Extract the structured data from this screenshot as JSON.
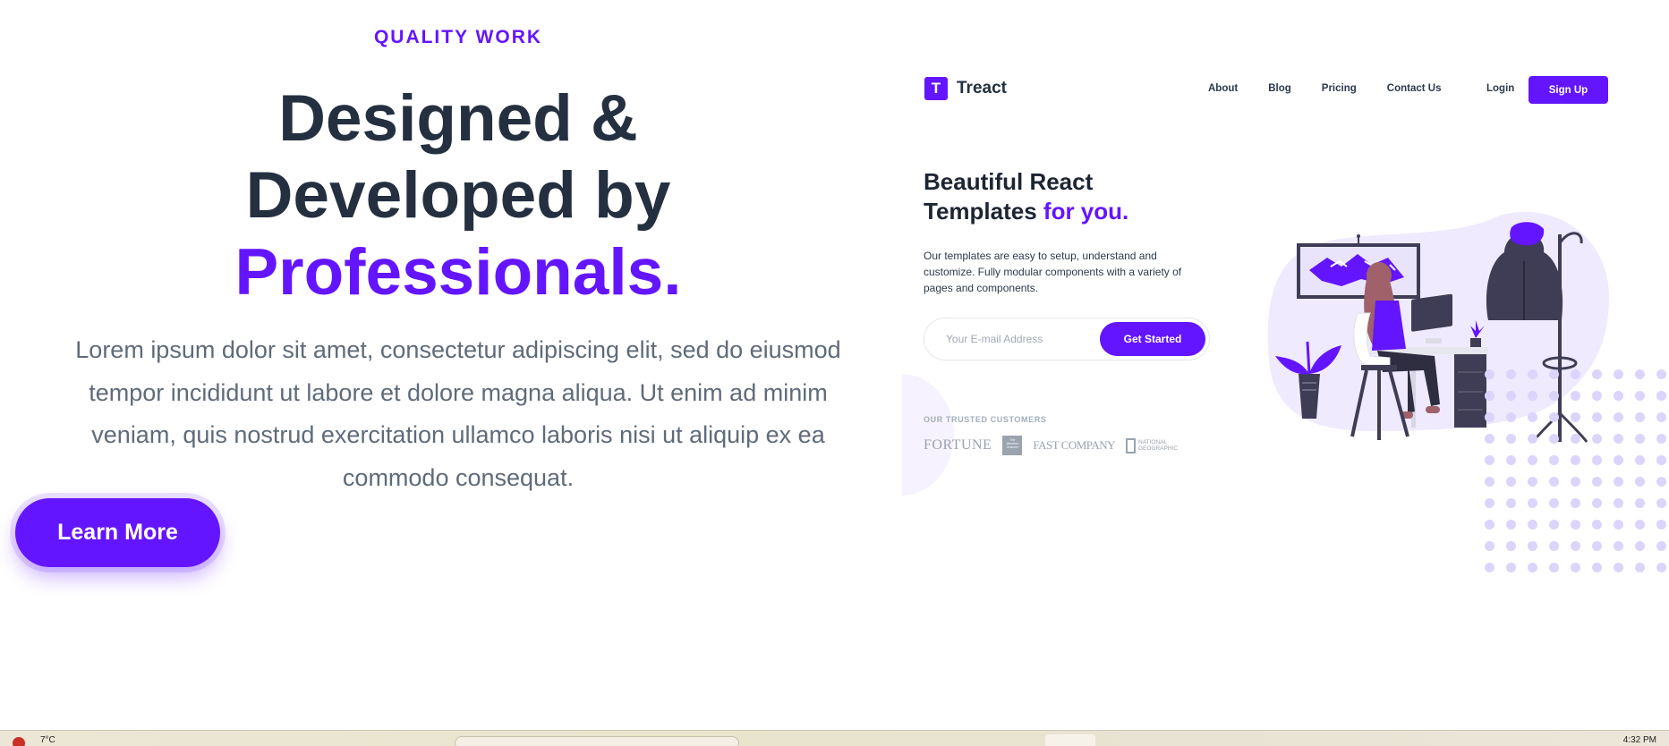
{
  "hero": {
    "eyebrow": "QUALITY WORK",
    "headline_line1": "Designed &",
    "headline_line2": "Developed by",
    "headline_accent": "Professionals.",
    "paragraph": "Lorem ipsum dolor sit amet, consectetur adipiscing elit, sed do eiusmod tempor incididunt ut labore et dolore magna aliqua. Ut enim ad minim veniam, quis nostrud exercitation ullamco laboris nisi ut aliquip ex ea commodo consequat.",
    "cta_label": "Learn More"
  },
  "preview": {
    "logo_mark": "T",
    "logo_text": "Treact",
    "nav": [
      "About",
      "Blog",
      "Pricing",
      "Contact Us"
    ],
    "login_label": "Login",
    "signup_label": "Sign Up",
    "title_line1": "Beautiful React",
    "title_line2": "Templates ",
    "title_accent": "for you.",
    "description": "Our templates are easy to setup, understand and customize. Fully modular components with a variety of pages and components.",
    "email_placeholder": "Your E-mail Address",
    "cta_label": "Get Started",
    "trusted_label": "OUR TRUSTED CUSTOMERS",
    "brands": {
      "fortune": "FORTUNE",
      "weather": "The Weather Channel",
      "fastcompany": "FAST COMPANY",
      "natgeo": "NATIONAL GEOGRAPHIC"
    }
  },
  "taskbar": {
    "app_label": "7°C",
    "clock": "4:32 PM"
  },
  "colors": {
    "accent": "#6415ff",
    "heading": "#243040",
    "body_text": "#5f6b7a"
  }
}
